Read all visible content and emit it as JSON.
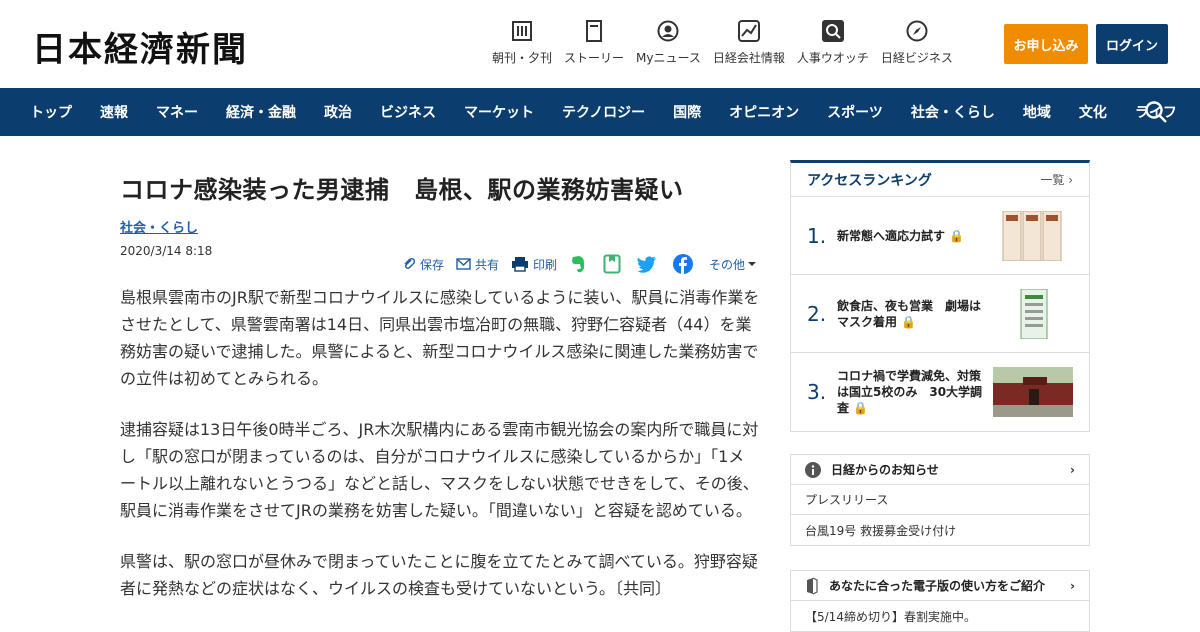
{
  "header": {
    "logo": "日本経濟新聞",
    "tools": [
      {
        "label": "朝刊・夕刊",
        "icon": "newspaper-icon"
      },
      {
        "label": "ストーリー",
        "icon": "book-icon"
      },
      {
        "label": "Myニュース",
        "icon": "user-icon"
      },
      {
        "label": "日経会社情報",
        "icon": "chart-icon"
      },
      {
        "label": "人事ウオッチ",
        "icon": "magnifier-icon"
      },
      {
        "label": "日経ビジネス",
        "icon": "compass-icon"
      }
    ],
    "apply_label": "お申し込み",
    "login_label": "ログイン"
  },
  "nav": {
    "items": [
      "トップ",
      "速報",
      "マネー",
      "経済・金融",
      "政治",
      "ビジネス",
      "マーケット",
      "テクノロジー",
      "国際",
      "オピニオン",
      "スポーツ",
      "社会・くらし",
      "地域",
      "文化",
      "ライフ"
    ]
  },
  "article": {
    "title": "コロナ感染装った男逮捕　島根、駅の業務妨害疑い",
    "category": "社会・くらし",
    "date": "2020/3/14 8:18",
    "share": {
      "save": "保存",
      "share": "共有",
      "print": "印刷",
      "more": "その他"
    },
    "paragraphs": [
      "島根県雲南市のJR駅で新型コロナウイルスに感染しているように装い、駅員に消毒作業をさせたとして、県警雲南署は14日、同県出雲市塩冶町の無職、狩野仁容疑者（44）を業務妨害の疑いで逮捕した。県警によると、新型コロナウイルス感染に関連した業務妨害での立件は初めてとみられる。",
      "逮捕容疑は13日午後0時半ごろ、JR木次駅構内にある雲南市観光協会の案内所で職員に対し「駅の窓口が閉まっているのは、自分がコロナウイルスに感染しているからか」「1メートル以上離れないとうつる」などと話し、マスクをしない状態でせきをして、その後、駅員に消毒作業をさせてJRの業務を妨害した疑い。「間違いない」と容疑を認めている。",
      "県警は、駅の窓口が昼休みで閉まっていたことに腹を立てたとみて調べている。狩野容疑者に発熱などの症状はなく、ウイルスの検査も受けていないという。〔共同〕"
    ]
  },
  "ranking": {
    "title": "アクセスランキング",
    "more": "一覧",
    "items": [
      {
        "num": "1.",
        "text": "新常態へ適応力試す"
      },
      {
        "num": "2.",
        "text": "飲食店、夜も営業　劇場はマスク着用"
      },
      {
        "num": "3.",
        "text": "コロナ禍で学費減免、対策は国立5校のみ　30大学調査"
      }
    ]
  },
  "notice": {
    "title": "日経からのお知らせ",
    "items": [
      "プレスリリース",
      "台風19号 救援募金受け付け"
    ]
  },
  "guide": {
    "title": "あなたに合った電子版の使い方をご紹介",
    "item": "【5/14締め切り】春割実施中。"
  },
  "colors": {
    "navy": "#0b3d6e",
    "orange": "#f08c00",
    "link": "#1d5fa8"
  }
}
